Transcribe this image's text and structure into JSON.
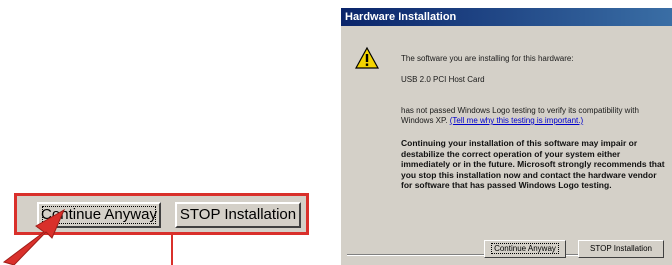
{
  "callout": {
    "continue_label": "Continue Anyway",
    "stop_label": "STOP Installation"
  },
  "dialog": {
    "title": "Hardware Installation",
    "line1": "The software you are installing for this hardware:",
    "device": "USB 2.0 PCI Host Card",
    "line3a": "has not passed Windows Logo testing to verify its compatibility with Windows XP. ",
    "link": "(Tell me why this testing is important.)",
    "warning": "Continuing your installation of this software may impair or destabilize the correct operation of your system either immediately or in the future. Microsoft strongly recommends that you stop this installation now and contact the hardware vendor for software that has passed Windows Logo testing.",
    "continue_label": "Continue Anyway",
    "stop_label": "STOP Installation"
  },
  "colors": {
    "callout_border": "#d9302b",
    "titlebar_start": "#0a246a",
    "titlebar_end": "#3a6ea5",
    "dialog_bg": "#d4d0c8"
  },
  "icons": {
    "warning": "warning-icon",
    "arrow": "pointer-arrow-icon"
  }
}
